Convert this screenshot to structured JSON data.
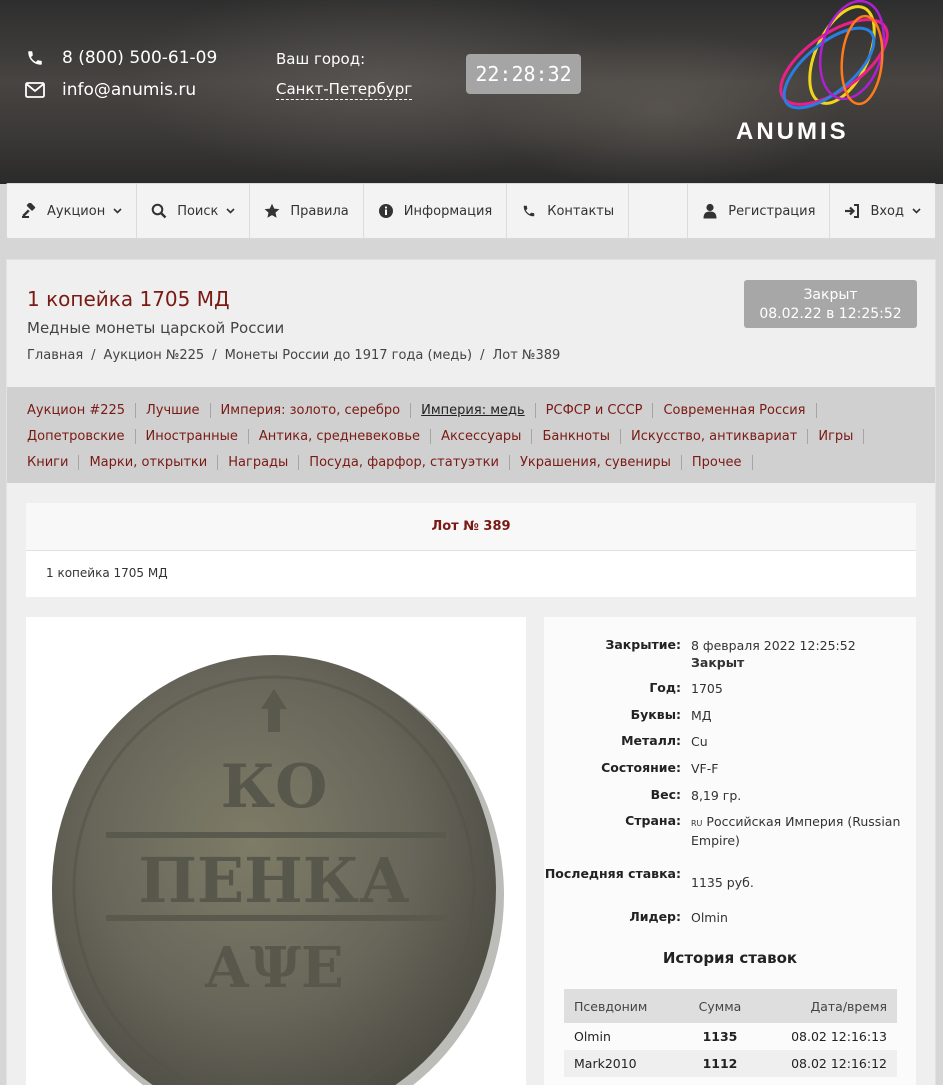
{
  "header": {
    "phone": "8 (800) 500-61-09",
    "email": "info@anumis.ru",
    "city_label": "Ваш город:",
    "city_value": "Санкт-Петербург",
    "clock": "22:28:32",
    "logo_text": "ANUMIS",
    "icons": [
      "phone-icon",
      "envelope-icon"
    ]
  },
  "nav": {
    "auction": "Аукцион",
    "search": "Поиск",
    "rules": "Правила",
    "info": "Информация",
    "contacts": "Контакты",
    "register": "Регистрация",
    "login": "Вход"
  },
  "lot": {
    "title": "1 копейка 1705 МД",
    "subtitle": "Медные монеты царской России",
    "status_line1": "Закрыт",
    "status_line2": "08.02.22 в 12:25:52",
    "breadcrumb": [
      "Главная",
      "Аукцион №225",
      "Монеты России до 1917 года (медь)",
      "Лот №389"
    ],
    "breadcrumb_sep": "/",
    "header": "Лот № 389",
    "description": "1 копейка 1705 МД"
  },
  "categories": {
    "row1": [
      "Аукцион #225",
      "Лучшие",
      "Империя: золото, серебро",
      "Империя: медь",
      "РСФСР и СССР",
      "Современная Россия"
    ],
    "row2": [
      "Допетровские",
      "Иностранные",
      "Антика, средневековье",
      "Аксессуары",
      "Банкноты",
      "Искусство, антиквариат",
      "Игры"
    ],
    "row3": [
      "Книги",
      "Марки, открытки",
      "Награды",
      "Посуда, фарфор, статуэтки",
      "Украшения, сувениры",
      "Прочее"
    ],
    "active": "Империя: медь"
  },
  "details": {
    "closing_label": "Закрытие:",
    "closing_value": "8 февраля 2022 12:25:52",
    "closing_status": "Закрыт",
    "year_label": "Год:",
    "year_value": "1705",
    "letters_label": "Буквы:",
    "letters_value": "МД",
    "metal_label": "Металл:",
    "metal_value": "Cu",
    "condition_label": "Состояние:",
    "condition_value": "VF-F",
    "weight_label": "Вес:",
    "weight_value": "8,19 гр.",
    "country_label": "Страна:",
    "country_flag": "RU",
    "country_value": "Российская Империя (Russian Empire)",
    "last_bid_label": "Последняя ставка:",
    "last_bid_value": "1135 руб.",
    "leader_label": "Лидер:",
    "leader_value": "Olmin"
  },
  "history": {
    "title": "История ставок",
    "columns": [
      "Псевдоним",
      "Сумма",
      "Дата/время"
    ],
    "rows": [
      {
        "nick": "Olmin",
        "sum": "1135",
        "time": "08.02 12:16:13"
      },
      {
        "nick": "Mark2010",
        "sum": "1112",
        "time": "08.02 12:16:12"
      }
    ]
  },
  "coin_inscription": {
    "line1": "КО",
    "line2": "ПЕНКА",
    "line3": "АΨЕ"
  },
  "colors": {
    "accent": "#7a1a14",
    "header_bg": "#3a3836",
    "badge_bg": "#a7a7a7"
  }
}
